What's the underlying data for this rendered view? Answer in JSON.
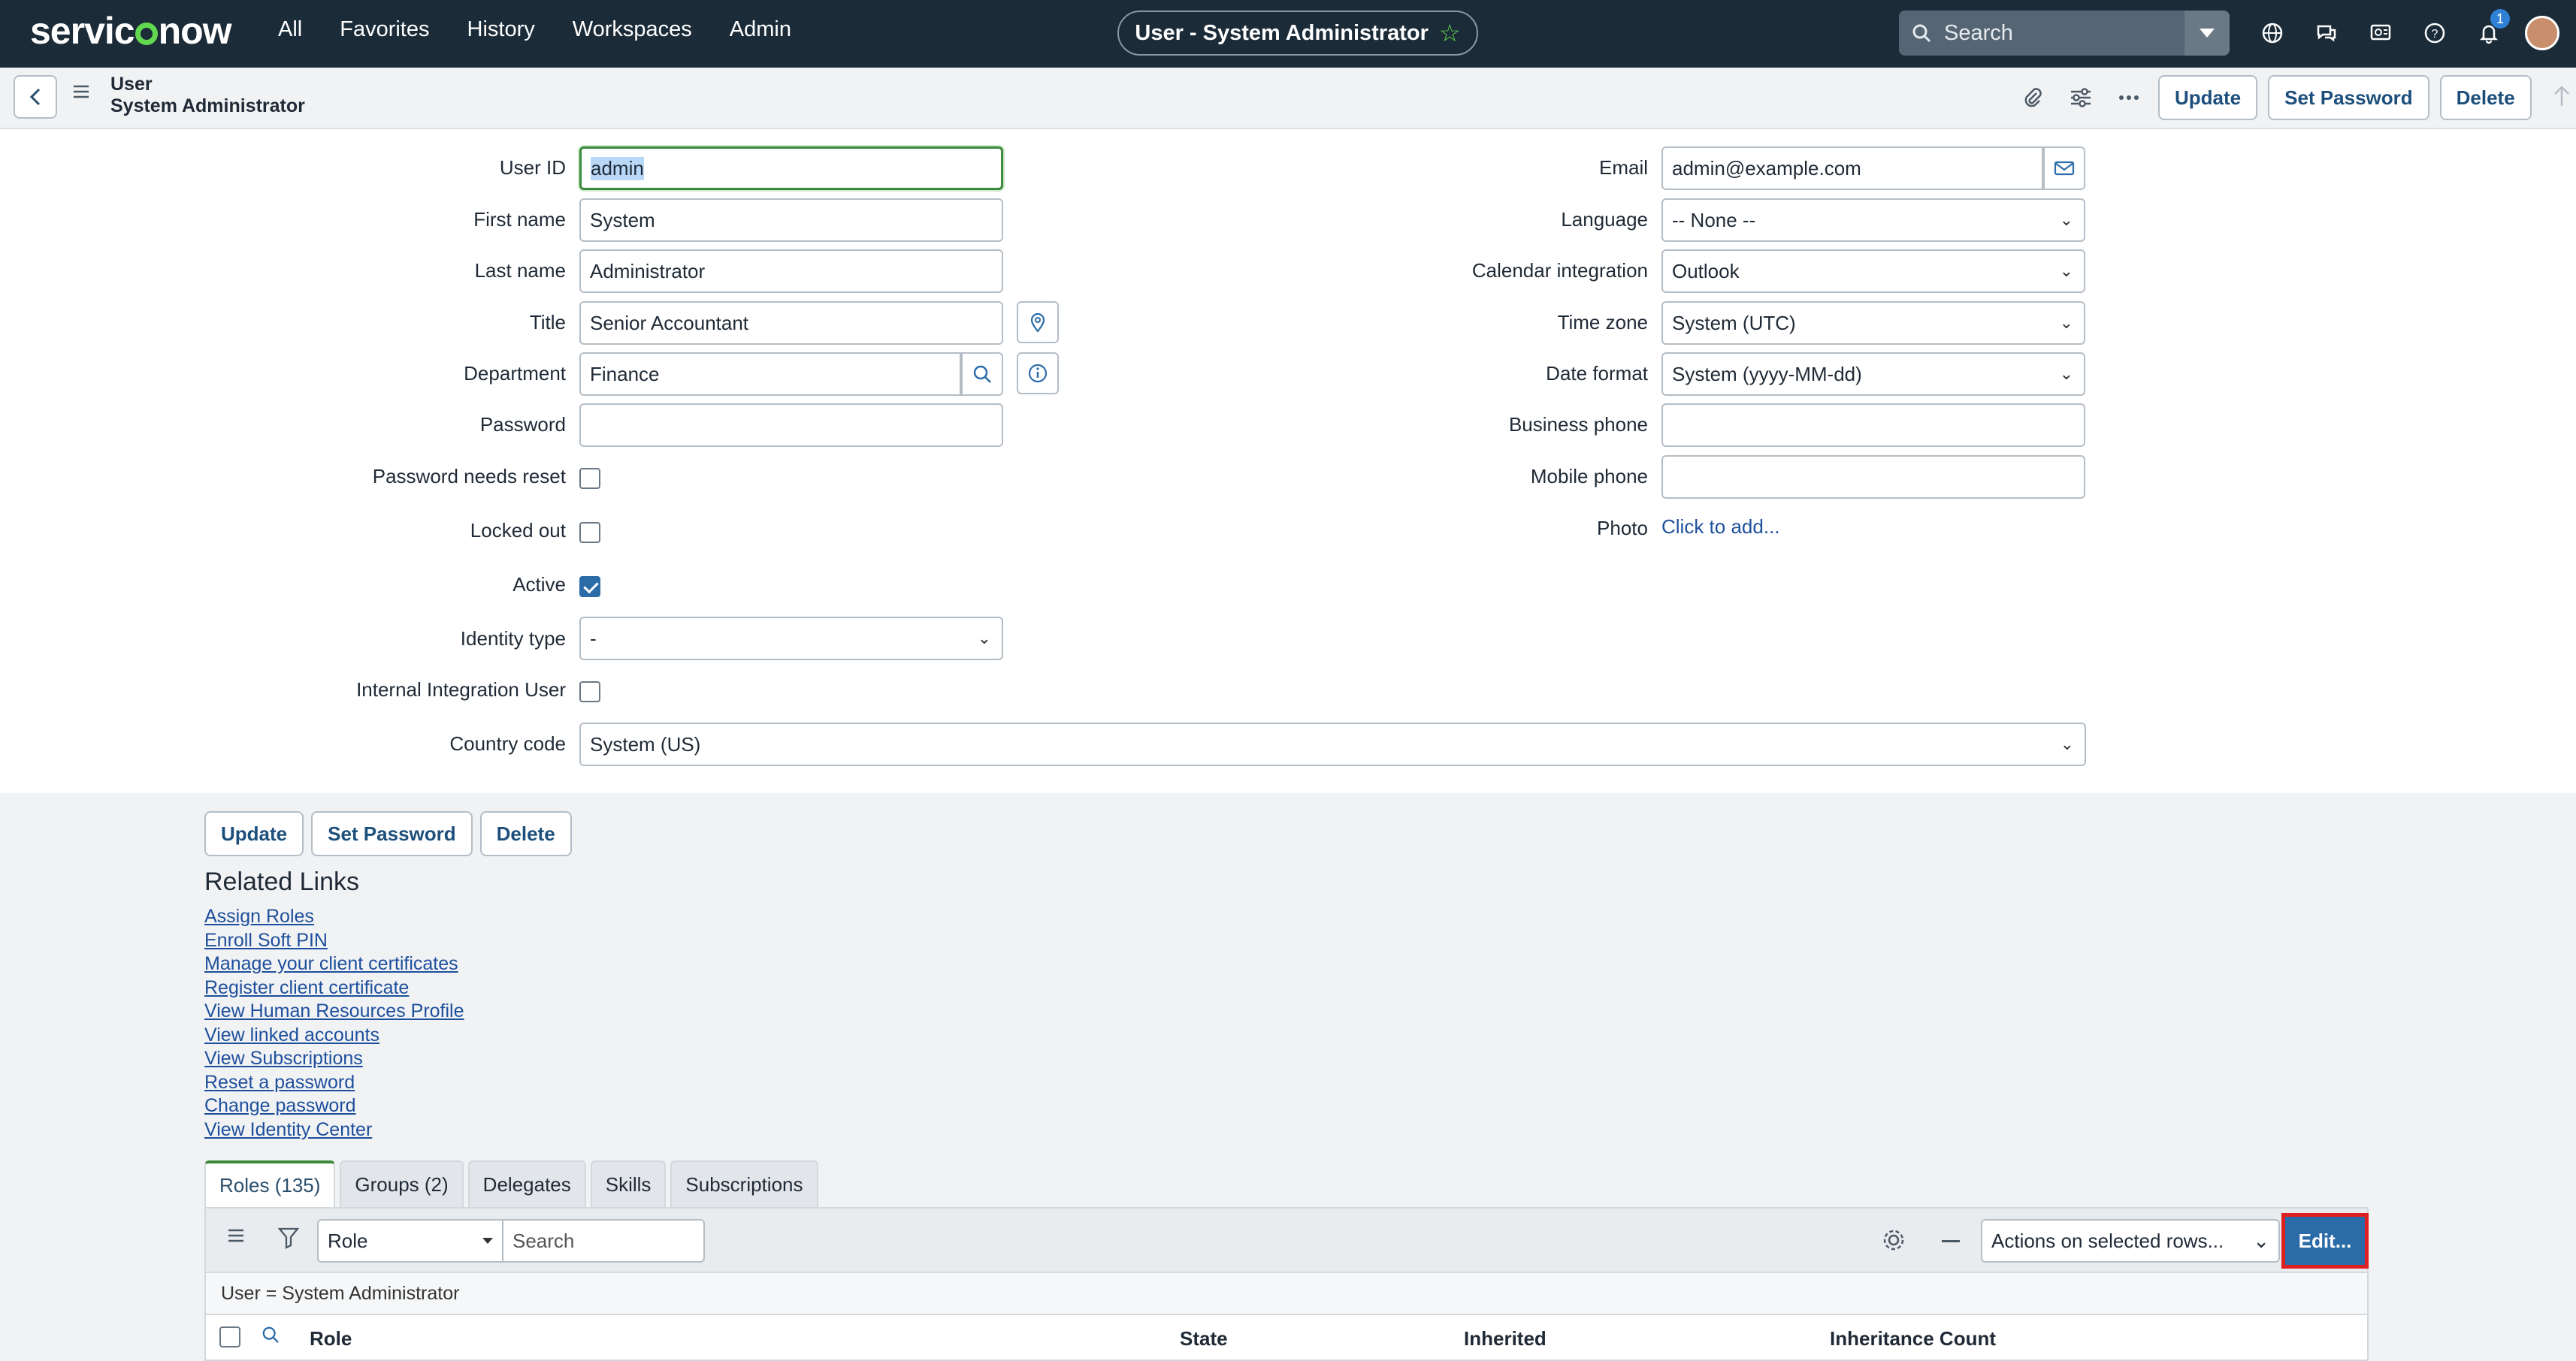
{
  "nav": {
    "brand_prefix": "servic",
    "brand_suffix": "now",
    "links": [
      "All",
      "Favorites",
      "History",
      "Workspaces",
      "Admin"
    ],
    "context_title": "User - System Administrator",
    "search_placeholder": "Search",
    "notification_count": "1"
  },
  "header": {
    "record_type": "User",
    "record_name": "System Administrator",
    "update_label": "Update",
    "set_password_label": "Set Password",
    "delete_label": "Delete"
  },
  "form": {
    "left": {
      "user_id": {
        "label": "User ID",
        "value": "admin"
      },
      "first_name": {
        "label": "First name",
        "value": "System"
      },
      "last_name": {
        "label": "Last name",
        "value": "Administrator"
      },
      "title": {
        "label": "Title",
        "value": "Senior Accountant"
      },
      "department": {
        "label": "Department",
        "value": "Finance"
      },
      "password": {
        "label": "Password",
        "value": ""
      },
      "password_needs_reset": {
        "label": "Password needs reset",
        "checked": false
      },
      "locked_out": {
        "label": "Locked out",
        "checked": false
      },
      "active": {
        "label": "Active",
        "checked": true
      },
      "identity_type": {
        "label": "Identity type",
        "value": "-"
      },
      "internal_integration_user": {
        "label": "Internal Integration User",
        "checked": false
      },
      "country_code": {
        "label": "Country code",
        "value": "System (US)"
      }
    },
    "right": {
      "email": {
        "label": "Email",
        "value": "admin@example.com"
      },
      "language": {
        "label": "Language",
        "value": "-- None --"
      },
      "calendar_integration": {
        "label": "Calendar integration",
        "value": "Outlook"
      },
      "time_zone": {
        "label": "Time zone",
        "value": "System (UTC)"
      },
      "date_format": {
        "label": "Date format",
        "value": "System (yyyy-MM-dd)"
      },
      "business_phone": {
        "label": "Business phone",
        "value": ""
      },
      "mobile_phone": {
        "label": "Mobile phone",
        "value": ""
      },
      "photo": {
        "label": "Photo",
        "link": "Click to add..."
      }
    }
  },
  "bottom_buttons": {
    "update": "Update",
    "set_password": "Set Password",
    "delete": "Delete"
  },
  "related_links": {
    "title": "Related Links",
    "items": [
      "Assign Roles",
      "Enroll Soft PIN",
      "Manage your client certificates",
      "Register client certificate",
      "View Human Resources Profile",
      "View linked accounts",
      "View Subscriptions",
      "Reset a password",
      "Change password",
      "View Identity Center"
    ]
  },
  "related_list": {
    "tabs": [
      "Roles (135)",
      "Groups (2)",
      "Delegates",
      "Skills",
      "Subscriptions"
    ],
    "active_tab": 0,
    "search_field": "Role",
    "search_placeholder": "Search",
    "actions_select": "Actions on selected rows...",
    "edit_button": "Edit...",
    "filter_breadcrumb": "User = System Administrator",
    "columns": [
      "Role",
      "State",
      "Inherited",
      "Inheritance Count"
    ]
  },
  "colors": {
    "nav_bg": "#1b2b38",
    "brand_accent": "#62d84e",
    "link": "#1d4f9c",
    "primary_button": "#2b6ca8",
    "highlight_border": "#e02020"
  }
}
